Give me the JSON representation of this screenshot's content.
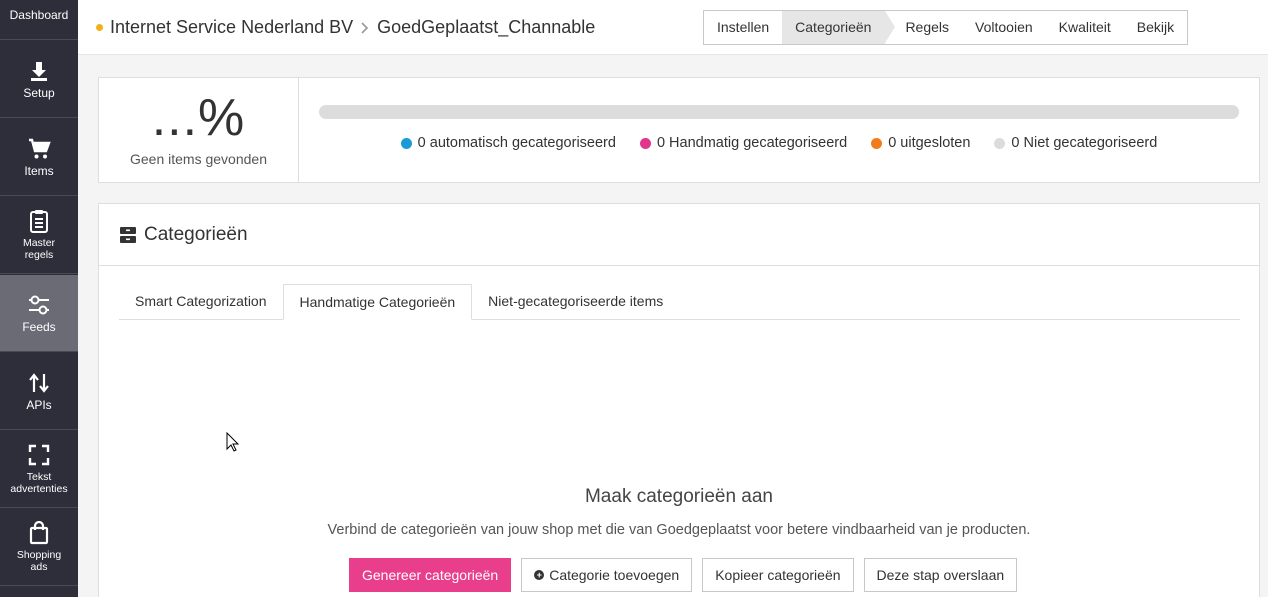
{
  "sidebar": {
    "items": [
      {
        "label": "Dashboard",
        "icon": "dashboard-icon"
      },
      {
        "label": "Setup",
        "icon": "download-icon"
      },
      {
        "label": "Items",
        "icon": "cart-icon"
      },
      {
        "label_line1": "Master",
        "label_line2": "regels",
        "icon": "clipboard-icon"
      },
      {
        "label": "Feeds",
        "icon": "sliders-icon",
        "active": true
      },
      {
        "label": "APIs",
        "icon": "swap-arrows-icon"
      },
      {
        "label_line1": "Tekst",
        "label_line2": "advertenties",
        "icon": "focus-frame-icon"
      },
      {
        "label_line1": "Shopping",
        "label_line2": "ads",
        "icon": "shopping-bag-icon"
      }
    ]
  },
  "header": {
    "company": "Internet Service Nederland BV",
    "feed_name": "GoedGeplaatst_Channable",
    "steps": [
      "Instellen",
      "Categorieën",
      "Regels",
      "Voltooien",
      "Kwaliteit",
      "Bekijk"
    ],
    "active_step": "Categorieën",
    "colors": {
      "status_dot": "#f2b01e"
    }
  },
  "progress": {
    "percent_text": "...%",
    "subtitle": "Geen items gevonden",
    "legend": [
      {
        "label": "0 automatisch gecategoriseerd",
        "color": "#1a9bd7"
      },
      {
        "label": "0 Handmatig gecategoriseerd",
        "color": "#e0358a"
      },
      {
        "label": "0 uitgesloten",
        "color": "#f07c1a"
      },
      {
        "label": "0 Niet gecategoriseerd",
        "color": "#dcdcdc"
      }
    ]
  },
  "categories": {
    "title": "Categorieën",
    "tabs": [
      "Smart Categorization",
      "Handmatige Categorieën",
      "Niet-gecategoriseerde items"
    ],
    "active_tab": "Handmatige Categorieën",
    "empty_title": "Maak categorieën aan",
    "empty_desc": "Verbind de categorieën van jouw shop met die van Goedgeplaatst voor betere vindbaarheid van je producten.",
    "buttons": {
      "generate": "Genereer categorieën",
      "add": "Categorie toevoegen",
      "copy": "Kopieer categorieën",
      "skip": "Deze stap overslaan"
    },
    "colors": {
      "primary": "#e83e8c"
    }
  }
}
